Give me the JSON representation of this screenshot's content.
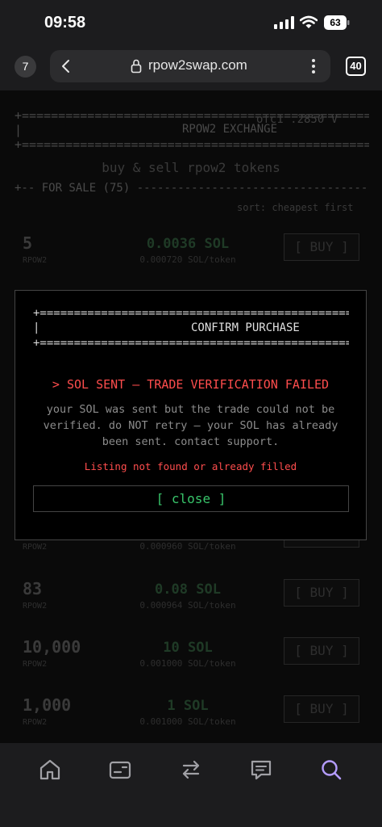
{
  "status_bar": {
    "time": "09:58",
    "battery": "63"
  },
  "browser": {
    "tab_badge": "7",
    "url": "rpow2swap.com",
    "tabs_count": "40"
  },
  "page": {
    "exchange_title": "RPOW2 EXCHANGE",
    "price_corner": "ofc1 .2850 V",
    "tagline": "buy & sell rpow2 tokens",
    "for_sale": "+-- FOR SALE (75) -----------------------------------------",
    "sort": "sort: cheapest first",
    "listings": [
      {
        "amount": "5",
        "unit": "RPOW2",
        "price": "0.0036 SOL",
        "rate": "0.000720 SOL/token",
        "buy": "[ BUY ]"
      },
      {
        "amount": "",
        "unit": "RPOW2",
        "price": "",
        "rate": "0.000960 SOL/token",
        "buy": "[ BUY ]"
      },
      {
        "amount": "83",
        "unit": "RPOW2",
        "price": "0.08 SOL",
        "rate": "0.000964 SOL/token",
        "buy": "[ BUY ]"
      },
      {
        "amount": "10,000",
        "unit": "RPOW2",
        "price": "10 SOL",
        "rate": "0.001000 SOL/token",
        "buy": "[ BUY ]"
      },
      {
        "amount": "1,000",
        "unit": "RPOW2",
        "price": "1 SOL",
        "rate": "0.001000 SOL/token",
        "buy": "[ BUY ]"
      }
    ]
  },
  "modal": {
    "border_top": "+==========================================================",
    "border_bar": "|",
    "title": "CONFIRM PURCHASE",
    "border_bottom": "+==========================================================",
    "heading": "> SOL SENT — TRADE VERIFICATION FAILED",
    "message": "your SOL was sent but the trade could not be verified. do NOT retry — your SOL has already been sent. contact support.",
    "error": "Listing not found or already filled",
    "close_label": "[ close ]"
  },
  "colors": {
    "accent_green": "#38c46a",
    "error_red": "#ff4d4d",
    "nav_active": "#b49cff"
  },
  "bottom_nav": {
    "items": [
      {
        "icon": "home-icon"
      },
      {
        "icon": "wallet-icon"
      },
      {
        "icon": "swap-icon"
      },
      {
        "icon": "chat-icon"
      },
      {
        "icon": "search-icon",
        "active": true
      }
    ]
  }
}
